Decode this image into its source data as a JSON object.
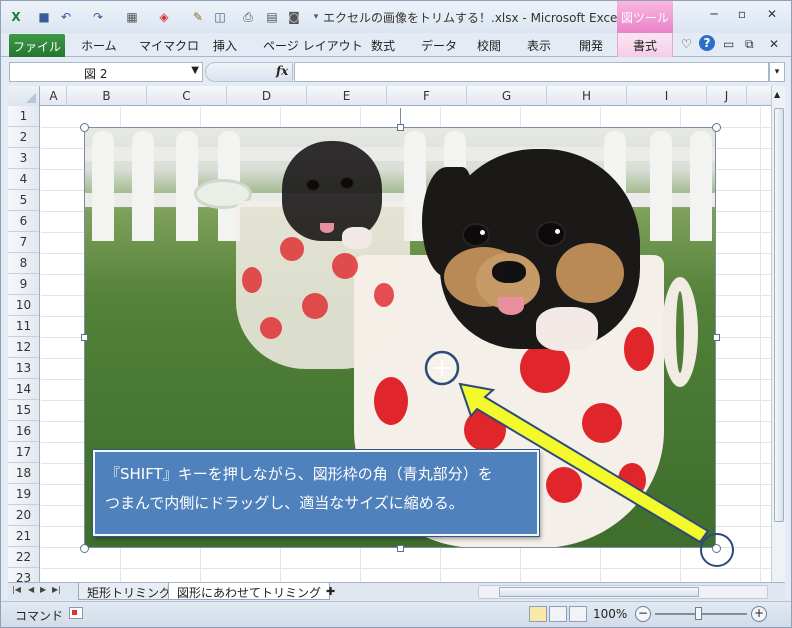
{
  "titlebar": {
    "title": "エクセルの画像をトリムする！.xlsx - Microsoft Excel",
    "contextual_tab": "図ツール"
  },
  "ribbon": {
    "file": "ファイル",
    "tabs": [
      "ホーム",
      "マイマクロ",
      "挿入",
      "ページ レイアウト",
      "数式",
      "データ",
      "校閲",
      "表示",
      "開発"
    ],
    "format_tab": "書式"
  },
  "formula_bar": {
    "name_box": "図 2",
    "fx": "fx",
    "formula": ""
  },
  "grid": {
    "columns": [
      "A",
      "B",
      "C",
      "D",
      "E",
      "F",
      "G",
      "H",
      "I",
      "J"
    ],
    "rows": [
      "1",
      "2",
      "3",
      "4",
      "5",
      "6",
      "7",
      "8",
      "9",
      "10",
      "11",
      "12",
      "13",
      "14",
      "15",
      "16",
      "17",
      "18",
      "19",
      "20",
      "21",
      "22",
      "23"
    ]
  },
  "callout": {
    "line1": "『SHIFT』キーを押しながら、図形枠の角（青丸部分）を",
    "line2": "つまんで内側にドラッグし、適当なサイズに縮める。"
  },
  "sheets": {
    "tabs": [
      "矩形トリミング",
      "図形にあわせてトリミング"
    ],
    "active_index": 1
  },
  "status": {
    "mode": "コマンド",
    "zoom": "100%"
  },
  "colors": {
    "callout_fill": "#4f81bd",
    "arrow_fill": "#f4f92c",
    "file_tab": "#2f8a3b",
    "picture_tools": "#e982c8"
  }
}
